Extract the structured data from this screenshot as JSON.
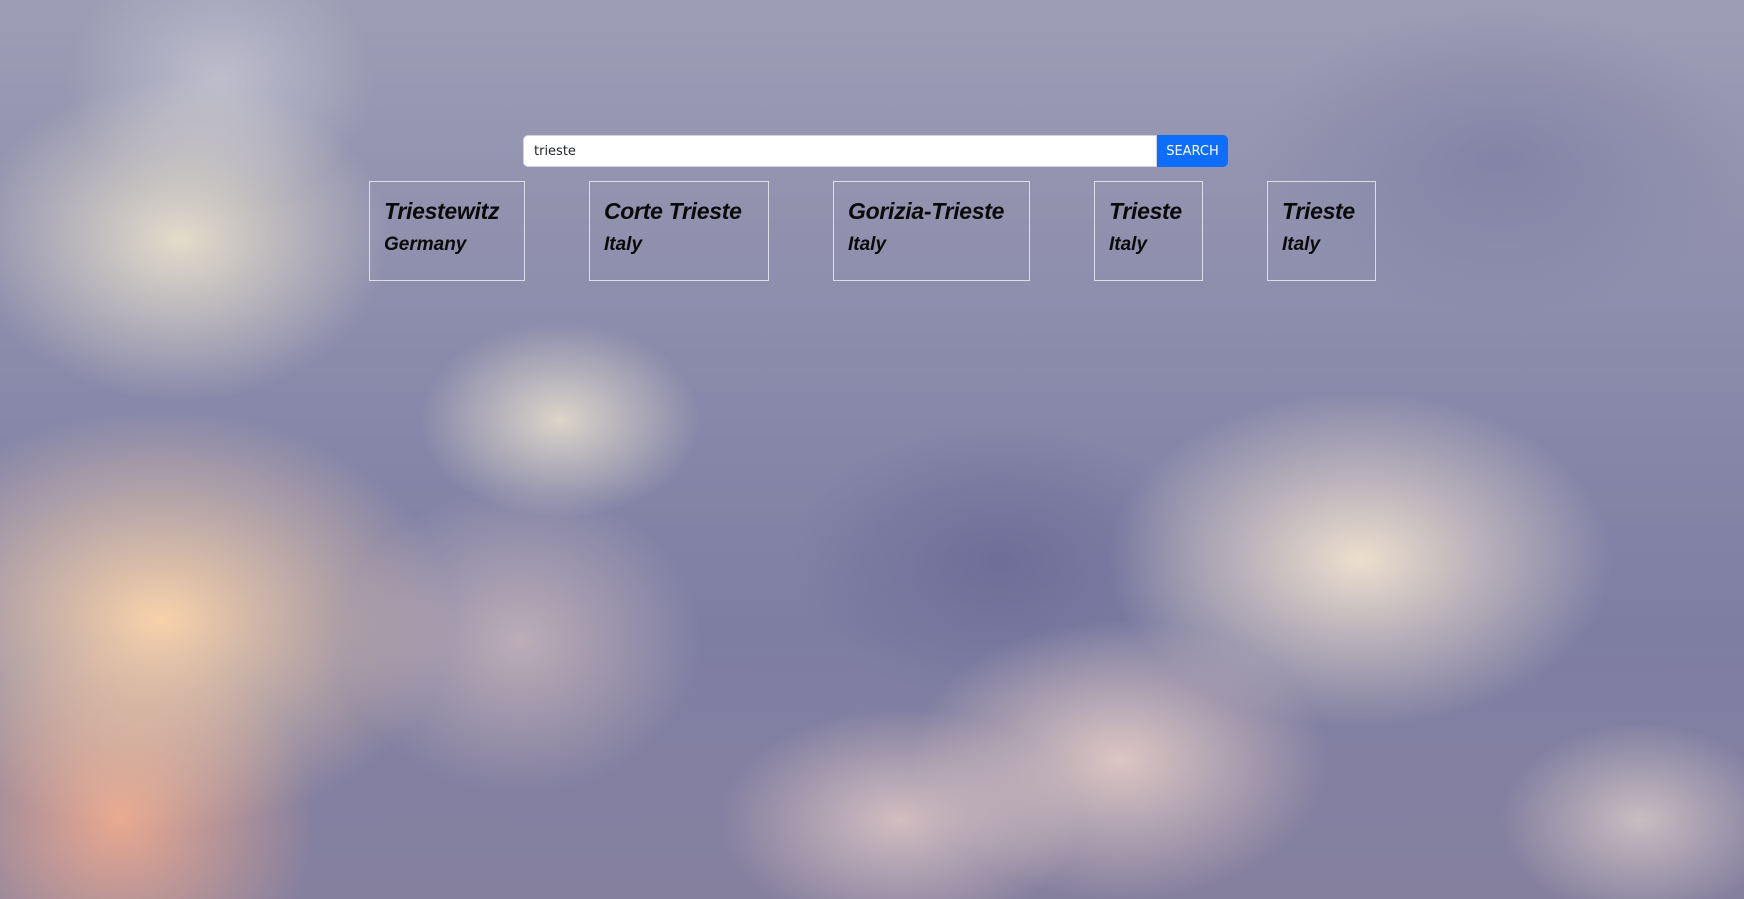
{
  "search": {
    "value": "trieste",
    "button_label": "SEARCH"
  },
  "results": [
    {
      "city": "Triestewitz",
      "country": "Germany"
    },
    {
      "city": "Corte Trieste",
      "country": "Italy"
    },
    {
      "city": "Gorizia-Trieste",
      "country": "Italy"
    },
    {
      "city": "Trieste",
      "country": "Italy"
    },
    {
      "city": "Trieste",
      "country": "Italy"
    }
  ],
  "colors": {
    "button": "#0d6efd",
    "card_border": "#ebebf0",
    "text": "#0a0a0a"
  }
}
